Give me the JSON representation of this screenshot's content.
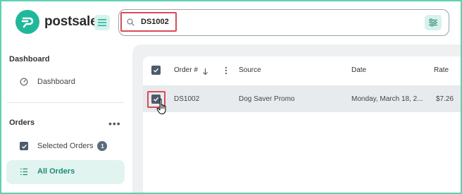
{
  "brand": {
    "name": "postsale",
    "trademark": "™",
    "accent": "#1fb89a"
  },
  "search": {
    "value": "DS1002"
  },
  "sidebar": {
    "sections": [
      {
        "title": "Dashboard",
        "items": [
          {
            "label": "Dashboard",
            "icon": "gauge-icon"
          }
        ]
      },
      {
        "title": "Orders",
        "items": [
          {
            "label": "Selected Orders",
            "icon": "checkbox-icon",
            "badge": "1"
          },
          {
            "label": "All Orders",
            "icon": "list-icon",
            "active": true
          }
        ]
      }
    ]
  },
  "table": {
    "columns": [
      "Order #",
      "Source",
      "Date",
      "Rate"
    ],
    "rows": [
      {
        "order": "DS1002",
        "source": "Dog Saver Promo",
        "date": "Monday, March 18, 2...",
        "rate": "$7.26",
        "selected": true
      }
    ]
  },
  "colors": {
    "highlight": "#d94b57",
    "frame": "#5fd0b3",
    "checkbox": "#4d5b6a"
  }
}
